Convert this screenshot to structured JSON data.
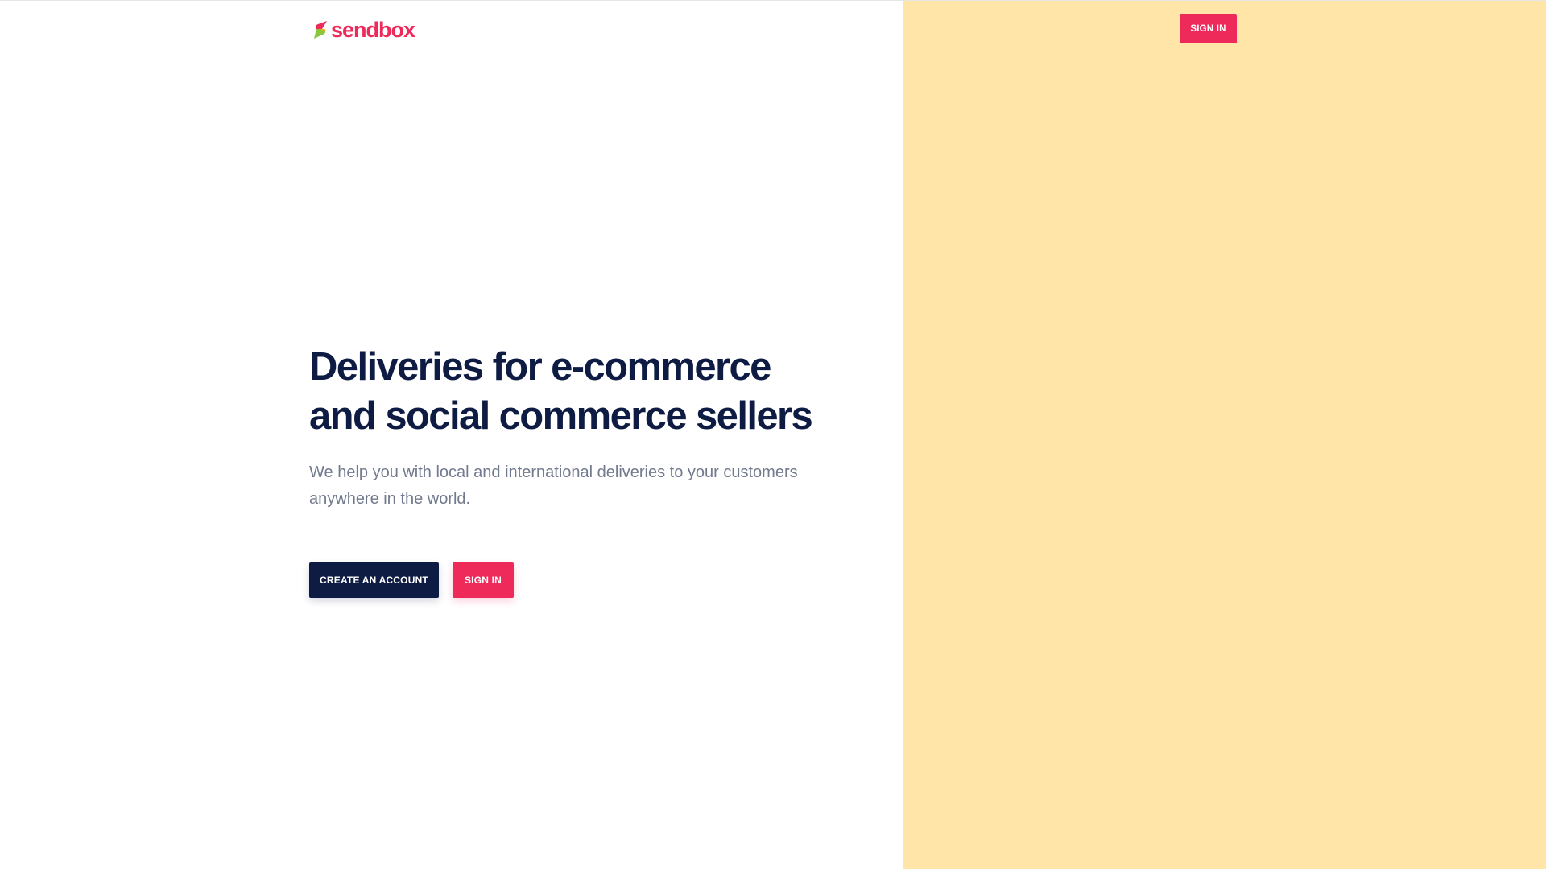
{
  "brand": {
    "name": "sendbox",
    "icon": "sendbox-s-icon",
    "colors": {
      "primary": "#ee2a5b",
      "dark": "#0e1c43",
      "accent_green": "#8cc63f",
      "panel": "#ffe5a8",
      "muted_text": "#727a8e"
    }
  },
  "header": {
    "signin_label": "SIGN IN"
  },
  "hero": {
    "title_line1": "Deliveries for e-commerce",
    "title_line2": "and social commerce sellers",
    "subtitle": "We help you with local and international deliveries to your customers anywhere in the world."
  },
  "cta": {
    "create_account_label": "CREATE AN ACCOUNT",
    "signin_label": "SIGN IN"
  }
}
